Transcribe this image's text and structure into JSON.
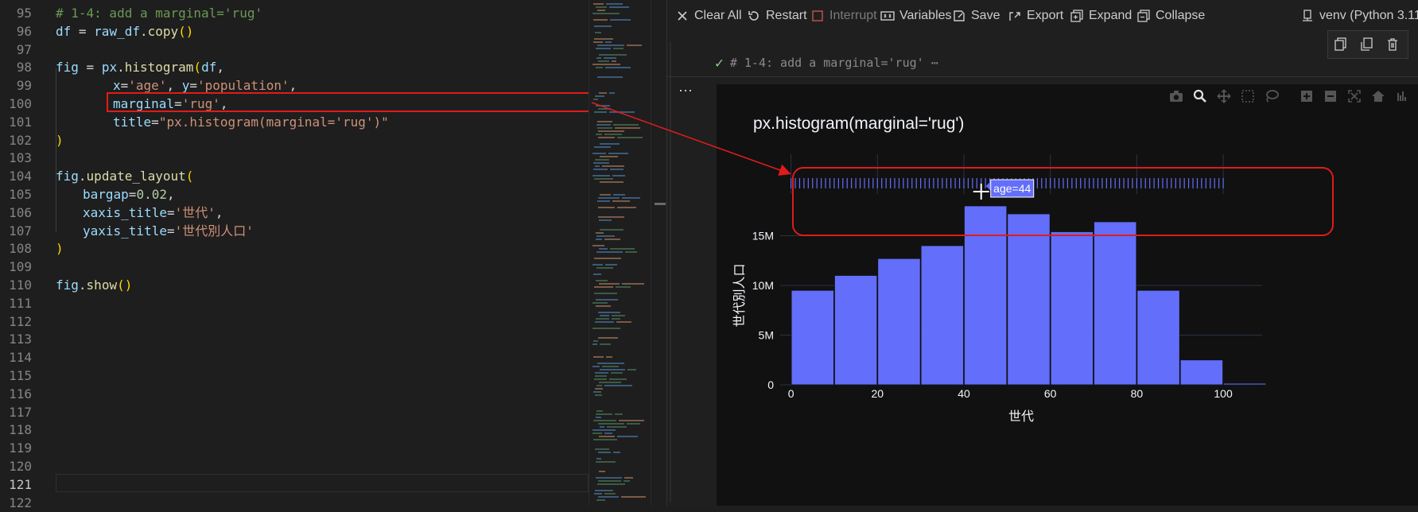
{
  "editor": {
    "lines": [
      {
        "n": "95",
        "html_id": "l95"
      },
      {
        "n": "96",
        "html_id": "l96"
      },
      {
        "n": "97",
        "html_id": "l97"
      },
      {
        "n": "98",
        "html_id": "l98"
      },
      {
        "n": "99",
        "html_id": "l99"
      },
      {
        "n": "100",
        "html_id": "l100"
      },
      {
        "n": "101",
        "html_id": "l101"
      },
      {
        "n": "102",
        "html_id": "l102"
      },
      {
        "n": "103",
        "html_id": "l103"
      },
      {
        "n": "104",
        "html_id": "l104"
      },
      {
        "n": "105",
        "html_id": "l105"
      },
      {
        "n": "106",
        "html_id": "l106"
      },
      {
        "n": "107",
        "html_id": "l107"
      },
      {
        "n": "108",
        "html_id": "l108"
      },
      {
        "n": "109",
        "html_id": "l109"
      },
      {
        "n": "110",
        "html_id": "l110"
      },
      {
        "n": "111",
        "html_id": "l111"
      },
      {
        "n": "112",
        "html_id": "l112"
      },
      {
        "n": "113",
        "html_id": "l113"
      },
      {
        "n": "114",
        "html_id": "l114"
      },
      {
        "n": "115",
        "html_id": "l115"
      },
      {
        "n": "116",
        "html_id": "l116"
      },
      {
        "n": "117",
        "html_id": "l117"
      },
      {
        "n": "118",
        "html_id": "l118"
      },
      {
        "n": "119",
        "html_id": "l119"
      },
      {
        "n": "120",
        "html_id": "l120"
      },
      {
        "n": "121",
        "html_id": "l121"
      },
      {
        "n": "122",
        "html_id": "l122"
      }
    ],
    "code": {
      "l95": "# 1-4: add a marginal='rug'",
      "l96_a": "df",
      "l96_b": " = ",
      "l96_c": "raw_df",
      "l96_d": ".",
      "l96_e": "copy",
      "l96_f": "()",
      "l98_a": "fig",
      "l98_b": " = ",
      "l98_c": "px",
      "l98_d": ".",
      "l98_e": "histogram",
      "l98_f": "(",
      "l98_g": "df",
      "l98_h": ",",
      "l99_a": "x",
      "l99_b": "=",
      "l99_c": "'age'",
      "l99_d": ", ",
      "l99_e": "y",
      "l99_f": "=",
      "l99_g": "'population'",
      "l99_h": ",",
      "l100_a": "marginal",
      "l100_b": "=",
      "l100_c": "'rug'",
      "l100_d": ",",
      "l101_a": "title",
      "l101_b": "=",
      "l101_c": "\"px.histogram(marginal='rug')\"",
      "l102": ")",
      "l104_a": "fig",
      "l104_b": ".",
      "l104_c": "update_layout",
      "l104_d": "(",
      "l105_a": "bargap",
      "l105_b": "=",
      "l105_c": "0.02",
      "l105_d": ",",
      "l106_a": "xaxis_title",
      "l106_b": "=",
      "l106_c": "'世代'",
      "l106_d": ",",
      "l107_a": "yaxis_title",
      "l107_b": "=",
      "l107_c": "'世代別人口'",
      "l108": ")",
      "l110_a": "fig",
      "l110_b": ".",
      "l110_c": "show",
      "l110_d": "()"
    }
  },
  "toolbar": {
    "clear_all": "Clear All",
    "restart": "Restart",
    "interrupt": "Interrupt",
    "variables": "Variables",
    "save": "Save",
    "export": "Export",
    "expand": "Expand",
    "collapse": "Collapse",
    "kernel": "venv (Python 3.11"
  },
  "cell": {
    "status_text": "# 1-4: add a marginal='rug' ⋯",
    "more": "⋯"
  },
  "plot": {
    "title": "px.histogram(marginal='rug')",
    "tooltip": "age=44"
  },
  "chart_data": {
    "type": "bar",
    "title": "px.histogram(marginal='rug')",
    "xlabel": "世代",
    "ylabel": "世代別人口",
    "x_bin_starts": [
      0,
      10,
      20,
      30,
      40,
      50,
      60,
      70,
      80,
      90,
      100
    ],
    "bin_width": 10,
    "values": [
      9500000,
      11000000,
      12700000,
      14000000,
      18000000,
      17200000,
      15400000,
      16400000,
      9500000,
      2500000,
      150000
    ],
    "xlim": [
      -2.5,
      109
    ],
    "ylim": [
      0,
      18000000
    ],
    "x_ticks": [
      0,
      20,
      40,
      60,
      80,
      100
    ],
    "x_tick_labels": [
      "0",
      "20",
      "40",
      "60",
      "80",
      "100"
    ],
    "y_ticks": [
      0,
      5000000,
      10000000,
      15000000
    ],
    "y_tick_labels": [
      "0",
      "5M",
      "10M",
      "15M"
    ],
    "marginal": "rug",
    "rug_points": [
      0,
      1,
      2,
      3,
      4,
      5,
      6,
      7,
      8,
      9,
      10,
      11,
      12,
      13,
      14,
      15,
      16,
      17,
      18,
      19,
      20,
      21,
      22,
      23,
      24,
      25,
      26,
      27,
      28,
      29,
      30,
      31,
      32,
      33,
      34,
      35,
      36,
      37,
      38,
      39,
      40,
      41,
      42,
      43,
      44,
      45,
      46,
      47,
      48,
      49,
      50,
      51,
      52,
      53,
      54,
      55,
      56,
      57,
      58,
      59,
      60,
      61,
      62,
      63,
      64,
      65,
      66,
      67,
      68,
      69,
      70,
      71,
      72,
      73,
      74,
      75,
      76,
      77,
      78,
      79,
      80,
      81,
      82,
      83,
      84,
      85,
      86,
      87,
      88,
      89,
      90,
      91,
      92,
      93,
      94,
      95,
      96,
      97,
      98,
      99,
      100
    ],
    "hover_label": "age=44",
    "grid": true,
    "bar_color": "#636efa",
    "background": "#111111"
  },
  "colors": {
    "highlight": "#e01b1b",
    "bar": "#636efa",
    "grid": "#283442"
  }
}
